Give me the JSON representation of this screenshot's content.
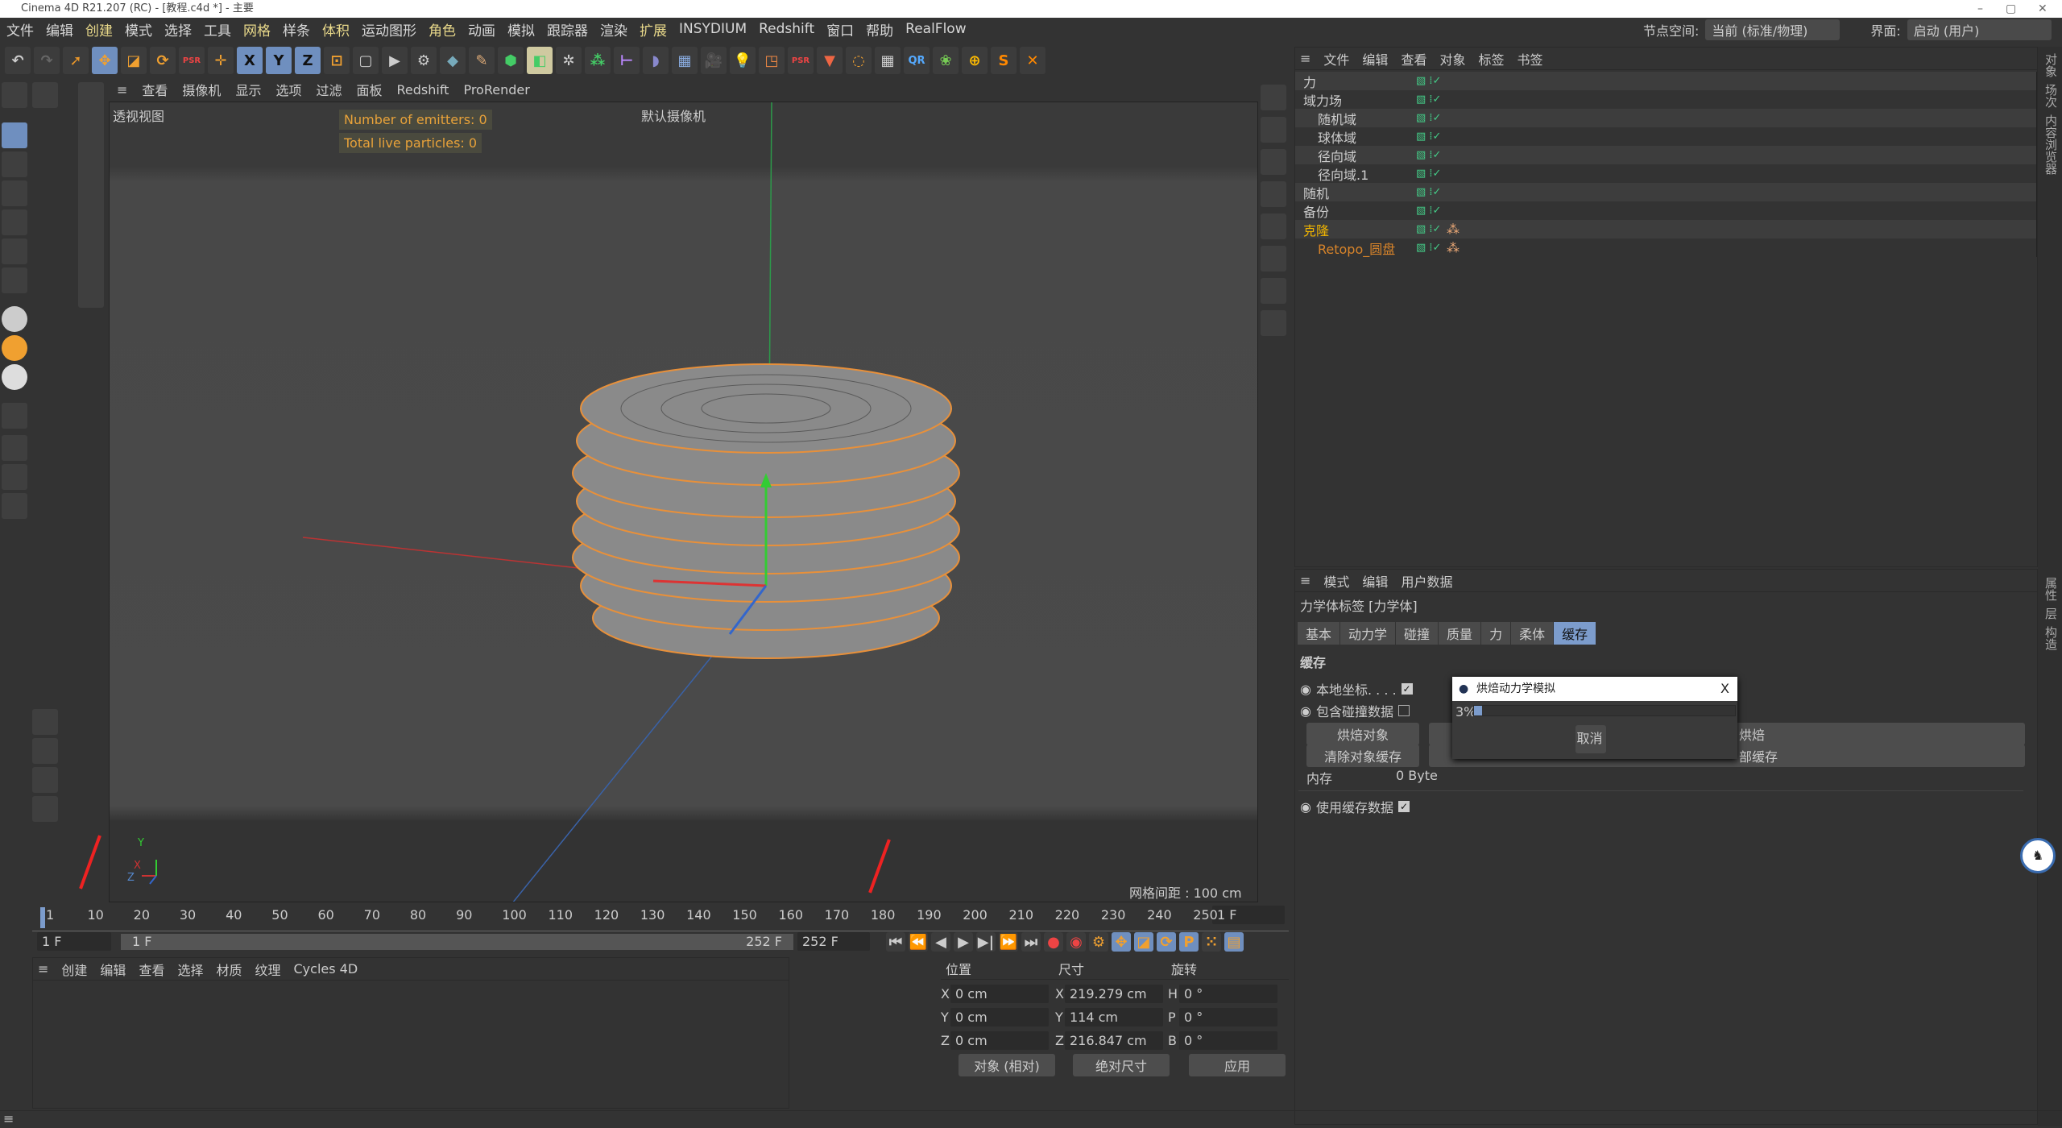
{
  "window": {
    "title": "Cinema 4D R21.207 (RC) - [教程.c4d *] - 主要",
    "minimize": "–",
    "maximize": "▢",
    "close": "✕"
  },
  "menu": [
    "文件",
    "编辑",
    "创建",
    "模式",
    "选择",
    "工具",
    "网格",
    "样条",
    "体积",
    "运动图形",
    "角色",
    "动画",
    "模拟",
    "跟踪器",
    "渲染",
    "扩展",
    "INSYDIUM",
    "Redshift",
    "窗口",
    "帮助",
    "RealFlow"
  ],
  "top_right": {
    "node_space_label": "节点空间:",
    "node_space_value": "当前 (标准/物理)",
    "layout_label": "界面:",
    "layout_value": "启动 (用户)"
  },
  "toolbar": {
    "axis": [
      "X",
      "Y",
      "Z"
    ]
  },
  "viewport": {
    "menu": [
      "查看",
      "摄像机",
      "显示",
      "选项",
      "过滤",
      "面板",
      "Redshift",
      "ProRender"
    ],
    "view_name": "透视视图",
    "emitters": "Number of emitters: 0",
    "particles": "Total live particles: 0",
    "camera": "默认摄像机",
    "grid": "网格间距 : 100 cm",
    "axis_x": "X",
    "axis_y": "Y",
    "axis_z": "Z"
  },
  "object_manager": {
    "menu": [
      "文件",
      "编辑",
      "查看",
      "对象",
      "标签",
      "书签"
    ],
    "objects": [
      {
        "name": "力",
        "level": 0,
        "color": "#cccccc"
      },
      {
        "name": "域力场",
        "level": 0,
        "color": "#cccccc"
      },
      {
        "name": "随机域",
        "level": 1,
        "color": "#cccccc"
      },
      {
        "name": "球体域",
        "level": 1,
        "color": "#cccccc"
      },
      {
        "name": "径向域",
        "level": 1,
        "color": "#cccccc"
      },
      {
        "name": "径向域.1",
        "level": 1,
        "color": "#cccccc"
      },
      {
        "name": "随机",
        "level": 0,
        "color": "#cccccc"
      },
      {
        "name": "备份",
        "level": 0,
        "color": "#cccccc"
      },
      {
        "name": "克隆",
        "level": 0,
        "color": "#f0b400"
      },
      {
        "name": "Retopo_圆盘",
        "level": 1,
        "color": "#d8842a"
      }
    ]
  },
  "side_tabs_top": [
    "对象",
    "场次",
    "内容浏览器"
  ],
  "side_tabs_bottom": [
    "属性",
    "层",
    "构造"
  ],
  "attributes": {
    "menu": [
      "模式",
      "编辑",
      "用户数据"
    ],
    "title": "力学体标签 [力学体]",
    "tabs": [
      "基本",
      "动力学",
      "碰撞",
      "质量",
      "力",
      "柔体",
      "缓存"
    ],
    "active_tab": "缓存",
    "section": "缓存",
    "local_coords": "本地坐标. . . .",
    "local_coords_checked": true,
    "include_collision": "包含碰撞数据",
    "include_collision_checked": false,
    "bake_object": "烘焙对象",
    "bake_all_suffix": "烘焙",
    "clear_object_cache": "清除对象缓存",
    "clear_all_suffix": "部缓存",
    "memory_label": "内存",
    "memory_value": "0 Byte",
    "use_cache": "使用缓存数据",
    "use_cache_checked": true
  },
  "dialog": {
    "title": "烘焙动力学模拟",
    "progress_text": "3%",
    "progress": 3,
    "cancel": "取消",
    "close": "X"
  },
  "timeline": {
    "ticks": [
      "1",
      "10",
      "20",
      "30",
      "40",
      "50",
      "60",
      "70",
      "80",
      "90",
      "100",
      "110",
      "120",
      "130",
      "140",
      "150",
      "160",
      "170",
      "180",
      "190",
      "200",
      "210",
      "220",
      "230",
      "240",
      "250"
    ],
    "current": "1 F",
    "start": "1 F",
    "range_start": "1 F",
    "range_end": "252 F",
    "end": "252 F"
  },
  "material_manager": {
    "menu": [
      "创建",
      "编辑",
      "查看",
      "选择",
      "材质",
      "纹理",
      "Cycles 4D"
    ]
  },
  "coordinates": {
    "headers": [
      "位置",
      "尺寸",
      "旋转"
    ],
    "rows": [
      {
        "pl": "X",
        "pos": "0 cm",
        "sl": "X",
        "size": "219.279 cm",
        "rl": "H",
        "rot": "0 °"
      },
      {
        "pl": "Y",
        "pos": "0 cm",
        "sl": "Y",
        "size": "114 cm",
        "rl": "P",
        "rot": "0 °"
      },
      {
        "pl": "Z",
        "pos": "0 cm",
        "sl": "Z",
        "size": "216.847 cm",
        "rl": "B",
        "rot": "0 °"
      }
    ],
    "mode": "对象 (相对)",
    "size_mode": "绝对尺寸",
    "apply": "应用"
  }
}
